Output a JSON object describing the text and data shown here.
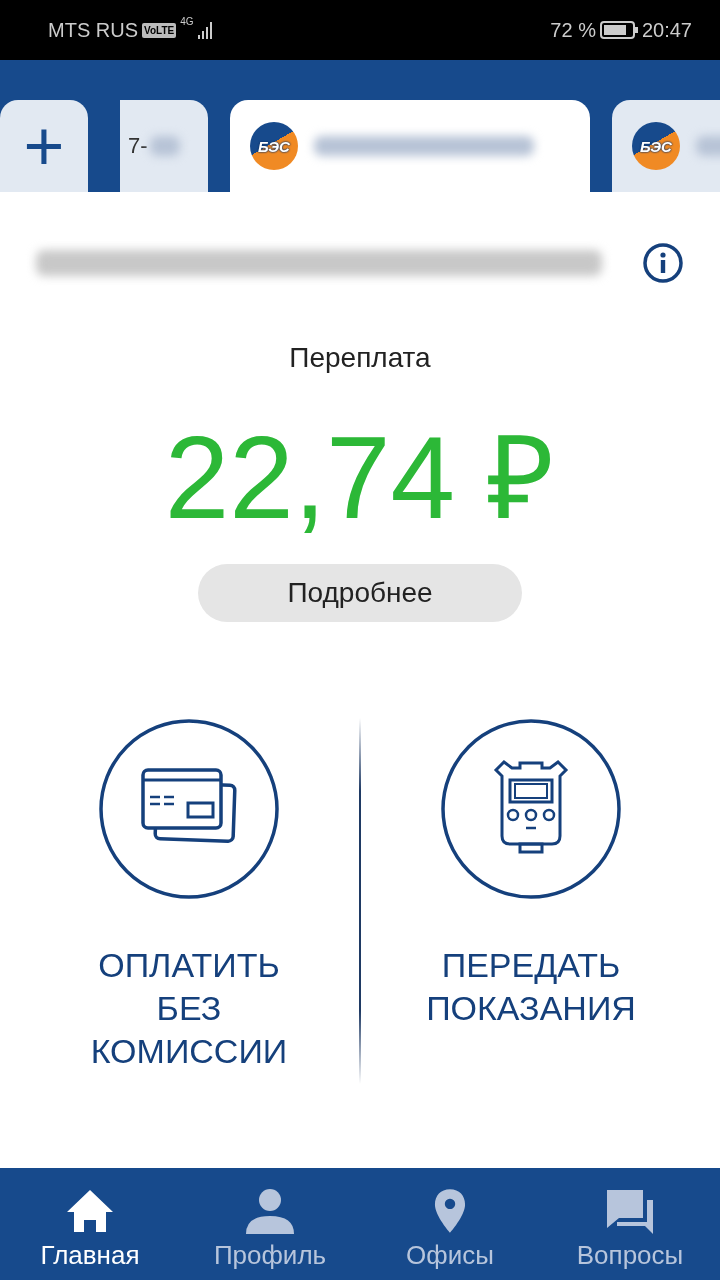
{
  "status_bar": {
    "carrier": "MTS RUS",
    "volte": "VoLTE",
    "network": "4G",
    "battery": "72 %",
    "time": "20:47"
  },
  "tabs": [
    {
      "kind": "add",
      "label": "+",
      "selected": false
    },
    {
      "kind": "account",
      "label": "7-",
      "selected": false
    },
    {
      "kind": "account",
      "logo": "БЭС",
      "selected": true
    },
    {
      "kind": "account",
      "logo": "БЭС",
      "selected": false
    }
  ],
  "balance": {
    "label": "Переплата",
    "amount": "22,74 ₽",
    "details_button": "Подробнее"
  },
  "actions": [
    {
      "kind": "card",
      "label": "ОПЛАТИТЬ БЕЗ КОМИССИИ"
    },
    {
      "kind": "meter",
      "label": "ПЕРЕДАТЬ ПОКАЗАНИЯ"
    }
  ],
  "nav": [
    {
      "kind": "home",
      "label": "Главная",
      "selected": true
    },
    {
      "kind": "profile",
      "label": "Профиль",
      "selected": false
    },
    {
      "kind": "pin",
      "label": "Офисы",
      "selected": false
    },
    {
      "kind": "chat",
      "label": "Вопросы",
      "selected": false
    }
  ]
}
